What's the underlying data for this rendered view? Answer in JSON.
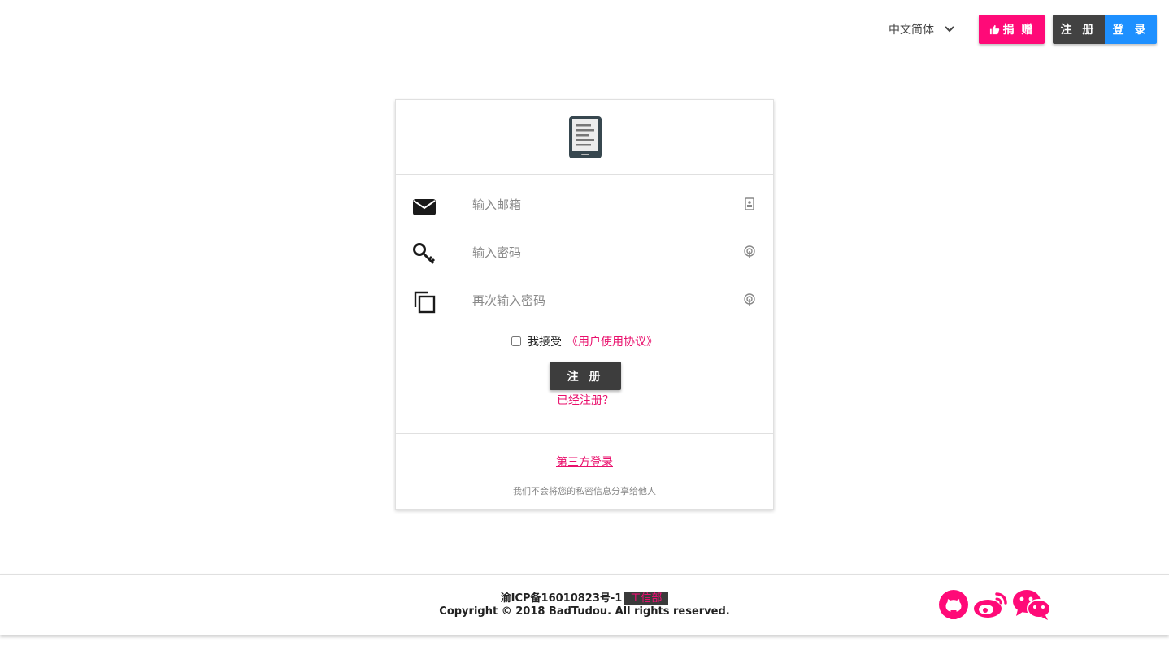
{
  "colors": {
    "accent": "#ff0a78",
    "dark_button": "#424242",
    "login_blue": "#1e90ff",
    "link_pink": "#e9106c"
  },
  "header": {
    "language": "中文简体",
    "donate_label": "捐 赠",
    "register_label": "注 册",
    "login_label": "登 录"
  },
  "form": {
    "email_placeholder": "输入邮箱",
    "password_placeholder": "输入密码",
    "confirm_placeholder": "再次输入密码",
    "agree_label": "我接受",
    "agreement_link": "《用户使用协议》",
    "submit_label": "注 册",
    "already_registered": "已经注册？",
    "third_party_login": "第三方登录",
    "privacy_note": "我们不会将您的私密信息分享给他人"
  },
  "footer": {
    "icp": "渝ICP备16010823号-1",
    "icp_badge": "工信部",
    "copyright": "Copyright © 2018 BadTudou. All rights reserved.",
    "social_icons": [
      "github-icon",
      "weibo-icon",
      "wechat-icon"
    ]
  }
}
